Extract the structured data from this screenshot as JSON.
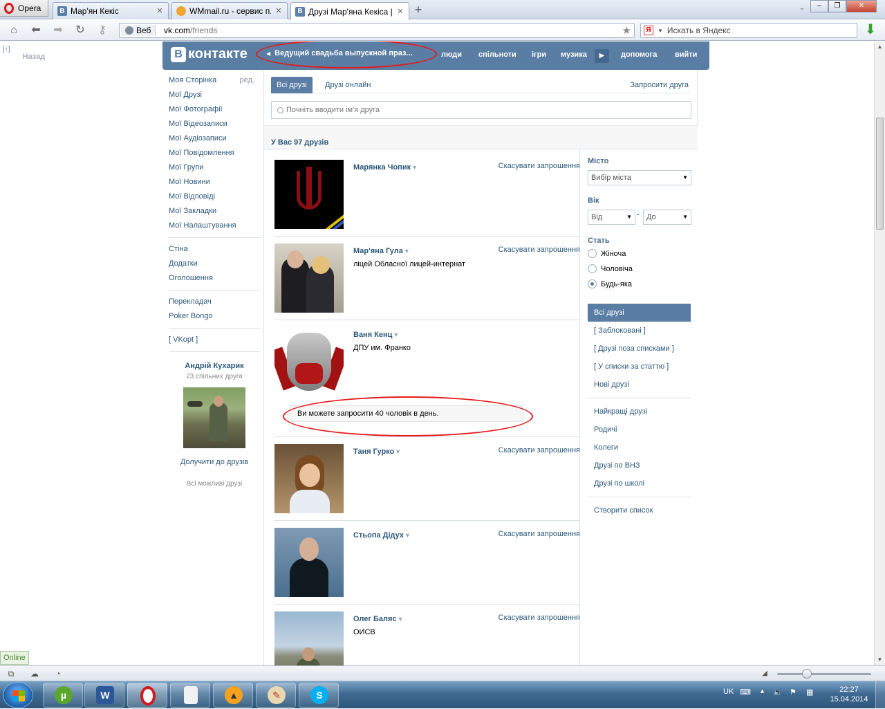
{
  "browser": {
    "menu_label": "Opera",
    "tabs": [
      {
        "title": "Мар'ян Кекіс",
        "icon": "vk-favicon"
      },
      {
        "title": "WMmail.ru - сервис п...",
        "icon": "wmmail-favicon"
      },
      {
        "title": "Друзі Мар'яна Кекіса |...",
        "icon": "vk-favicon",
        "active": true
      }
    ],
    "address_chip": "Веб",
    "url_host": "vk.com",
    "url_path": "/friends",
    "search_placeholder": "Искать в Яндекс",
    "search_engine_letter": "Я"
  },
  "page": {
    "back_arrow": "[↑]",
    "back_label": "Назад",
    "logo_letter": "В",
    "logo_text": "контакте",
    "player_title": "Ведущий свадьба выпускной праз...",
    "nav": [
      "люди",
      "спільноти",
      "ігри",
      "музика",
      "допомога",
      "вийти"
    ],
    "left_menu": {
      "edit_label": "ред.",
      "group1": [
        "Моя Сторінка",
        "Мої Друзі",
        "Мої Фотографії",
        "Мої Відеозаписи",
        "Мої Аудіозаписи",
        "Мої Повідомлення",
        "Мої Групи",
        "Мої Новини",
        "Мої Відповіді",
        "Мої Закладки",
        "Мої Налаштування"
      ],
      "group2": [
        "Стіна",
        "Додатки",
        "Оголошення"
      ],
      "group3": [
        "Перекладач",
        "Poker Bongo"
      ],
      "vkopt": "[ VKopt ]"
    },
    "suggestion": {
      "name": "Андрій Кухарик",
      "common": "23 спільних друга",
      "add": "Долучити до друзів",
      "all": "Всі можливі друзі"
    },
    "tabs": {
      "all": "Всі друзі",
      "online": "Друзі онлайн",
      "invite": "Запросити друга"
    },
    "search_placeholder": "Почніть вводити ім'я друга",
    "count_text": "У Вас 97 друзів",
    "cancel_label": "Скасувати запрошення",
    "friends": [
      {
        "name": "Марянка Чопик",
        "info": ""
      },
      {
        "name": "Мар'яна Гула",
        "info": "ліцей Обласної лицей-интернат"
      },
      {
        "name": "Ваня Кенц",
        "info": "ДПУ им. Франко"
      },
      {
        "name": "Таня Гурко",
        "info": ""
      },
      {
        "name": "Стьопа Дідух",
        "info": ""
      },
      {
        "name": "Олег Баляс",
        "info": "ОИСВ"
      }
    ],
    "invite_notice": "Ви можете запросити 40 чоловік в день.",
    "filters": {
      "city_label": "Місто",
      "city_select": "Вибір міста",
      "age_label": "Вік",
      "age_from": "Від",
      "age_to": "До",
      "age_dash": "-",
      "sex_label": "Стать",
      "sex_options": [
        "Жіноча",
        "Чоловіча",
        "Будь-яка"
      ],
      "sex_selected": 2,
      "lists_selected": "Всі друзі",
      "lists1": [
        "[ Заблоковані ]",
        "[ Друзі поза списками ]",
        "[ У списки за статтю ]",
        "Нові друзі"
      ],
      "lists2": [
        "Найкращі друзі",
        "Родичі",
        "Колеги",
        "Друзі по ВНЗ",
        "Друзі по школі"
      ],
      "create_list": "Створити список"
    }
  },
  "statusbar": {
    "online": "Online"
  },
  "taskbar": {
    "lang": "UK",
    "time": "22:27",
    "date": "15.04.2014"
  },
  "colors": {
    "vk_header": "#597da3",
    "vk_link": "#2b587a",
    "annotation_red": "#e61a1a"
  }
}
